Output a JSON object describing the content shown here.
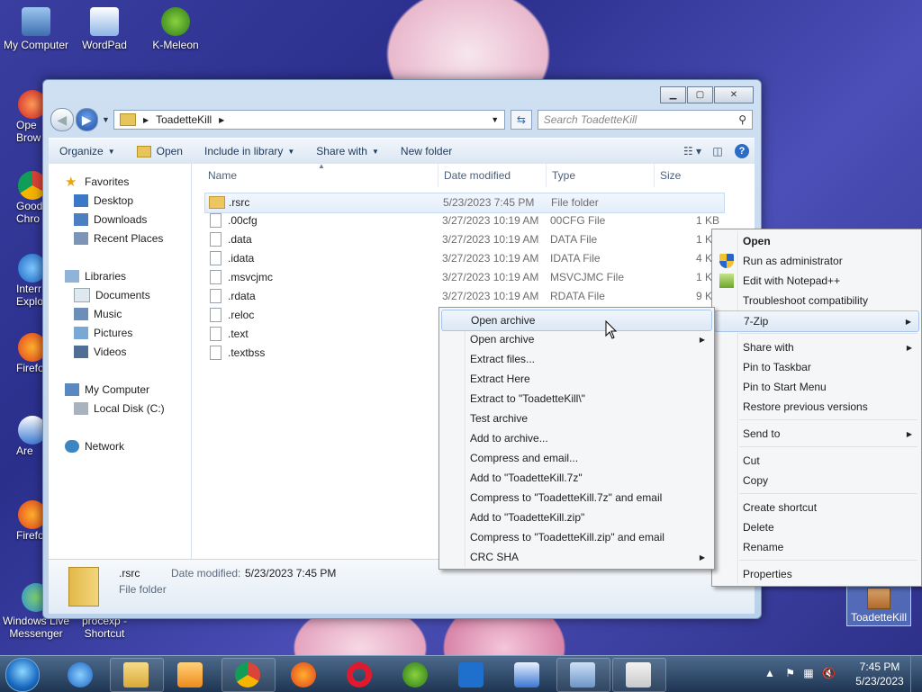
{
  "desktop": {
    "icons_top": [
      "My Computer",
      "WordPad",
      "K-Meleon"
    ],
    "icons_left_partial": [
      "Ope",
      "Brow",
      "Good",
      "Chro",
      "Interr",
      "Explo",
      "Firefo",
      "Are",
      "Firefo"
    ],
    "icons_bottom": [
      "Windows Live",
      "Messenger",
      "procexp -",
      "Shortcut"
    ],
    "selected_icon": "ToadetteKill"
  },
  "window": {
    "address_path": "ToadetteKill",
    "search_placeholder": "Search ToadetteKill",
    "toolbar": {
      "organize": "Organize",
      "open": "Open",
      "include_in_library": "Include in library",
      "share_with": "Share with",
      "new_folder": "New folder"
    },
    "nav": {
      "favorites": "Favorites",
      "desktop": "Desktop",
      "downloads": "Downloads",
      "recent_places": "Recent Places",
      "libraries": "Libraries",
      "documents": "Documents",
      "music": "Music",
      "pictures": "Pictures",
      "videos": "Videos",
      "my_computer": "My Computer",
      "local_disk": "Local Disk (C:)",
      "network": "Network"
    },
    "columns": {
      "name": "Name",
      "date_modified": "Date modified",
      "type": "Type",
      "size": "Size"
    },
    "files": [
      {
        "name": ".rsrc",
        "date": "5/23/2023 7:45 PM",
        "type": "File folder",
        "size": ""
      },
      {
        "name": ".00cfg",
        "date": "3/27/2023 10:19 AM",
        "type": "00CFG File",
        "size": "1 KB"
      },
      {
        "name": ".data",
        "date": "3/27/2023 10:19 AM",
        "type": "DATA File",
        "size": "1 K"
      },
      {
        "name": ".idata",
        "date": "3/27/2023 10:19 AM",
        "type": "IDATA File",
        "size": "4 K"
      },
      {
        "name": ".msvcjmc",
        "date": "3/27/2023 10:19 AM",
        "type": "MSVCJMC File",
        "size": "1 K"
      },
      {
        "name": ".rdata",
        "date": "3/27/2023 10:19 AM",
        "type": "RDATA File",
        "size": "9 K"
      },
      {
        "name": ".reloc",
        "date": "",
        "type": "",
        "size": ""
      },
      {
        "name": ".text",
        "date": "",
        "type": "",
        "size": ""
      },
      {
        "name": ".textbss",
        "date": "",
        "type": "",
        "size": ""
      }
    ],
    "details": {
      "name": ".rsrc",
      "date_label": "Date modified:",
      "date_value": "5/23/2023 7:45 PM",
      "type": "File folder"
    }
  },
  "context_menu": {
    "items": [
      "Open",
      "Run as administrator",
      "Edit with Notepad++",
      "Troubleshoot compatibility",
      "7-Zip",
      "Share with",
      "Pin to Taskbar",
      "Pin to Start Menu",
      "Restore previous versions",
      "Send to",
      "Cut",
      "Copy",
      "Create shortcut",
      "Delete",
      "Rename",
      "Properties"
    ]
  },
  "zip_menu": {
    "items": [
      "Open archive",
      "Open archive",
      "Extract files...",
      "Extract Here",
      "Extract to \"ToadetteKill\\\"",
      "Test archive",
      "Add to archive...",
      "Compress and email...",
      "Add to \"ToadetteKill.7z\"",
      "Compress to \"ToadetteKill.7z\" and email",
      "Add to \"ToadetteKill.zip\"",
      "Compress to \"ToadetteKill.zip\" and email",
      "CRC SHA"
    ]
  },
  "taskbar": {
    "time": "7:45 PM",
    "date": "5/23/2023"
  },
  "colors": {
    "accent": "#1b4fa8",
    "taskbar": "#1e3552",
    "menu_highlight": "#dce8f6"
  }
}
